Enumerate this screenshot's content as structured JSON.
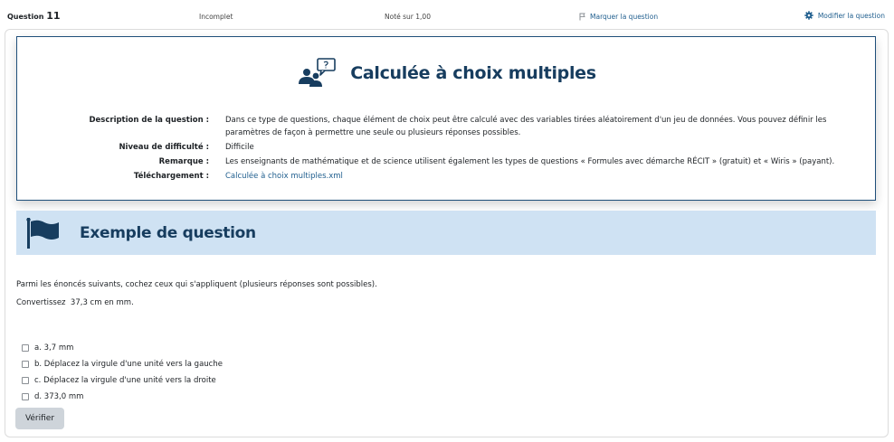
{
  "header": {
    "question_label": "Question",
    "question_number": "11",
    "state": "Incomplet",
    "grade": "Noté sur 1,00",
    "flag_label": "Marquer la question",
    "edit_label": "Modifier la question"
  },
  "info": {
    "title": "Calculée à choix multiples",
    "rows": [
      {
        "label": "Description de la question :",
        "value": "Dans ce type de questions, chaque élément de choix peut être calculé avec des variables tirées aléatoirement d'un jeu de données. Vous pouvez définir les paramètres de façon à permettre une seule ou plusieurs réponses possibles."
      },
      {
        "label": "Niveau de difficulté :",
        "value": "Difficile"
      },
      {
        "label": "Remarque :",
        "value": "Les enseignants de mathématique et de science utilisent également les types de questions « Formules avec démarche RÉCIT » (gratuit) et « Wiris » (payant)."
      },
      {
        "label": "Téléchargement :",
        "value": "Calculée à choix multiples.xml"
      }
    ]
  },
  "banner": {
    "title": "Exemple de question"
  },
  "question": {
    "instruction": "Parmi les énoncés suivants, cochez ceux qui s'appliquent (plusieurs réponses sont possibles).",
    "prompt": "Convertissez  37,3 cm en mm."
  },
  "answers": [
    {
      "label": "a. 3,7 mm"
    },
    {
      "label": "b. Déplacez la virgule d'une unité vers la gauche"
    },
    {
      "label": "c. Déplacez la virgule d'une unité vers la droite"
    },
    {
      "label": "d. 373,0 mm"
    }
  ],
  "actions": {
    "verify_label": "Vérifier"
  },
  "colors": {
    "accent": "#173d5f",
    "link": "#1f5e8e",
    "banner_bg": "#cfe2f3",
    "button_bg": "#ced4da"
  },
  "icons": {
    "flag": "flag-outline-icon",
    "edit": "gear-icon",
    "title": "users-chat-icon",
    "banner": "flag-icon"
  }
}
